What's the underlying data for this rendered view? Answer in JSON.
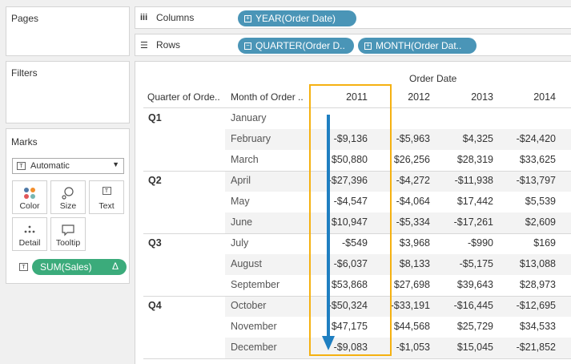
{
  "pages": {
    "title": "Pages"
  },
  "filters": {
    "title": "Filters"
  },
  "marks": {
    "title": "Marks",
    "type_value": "Automatic",
    "buttons": [
      {
        "label": "Color",
        "icon": "color-dots-icon"
      },
      {
        "label": "Size",
        "icon": "size-icon"
      },
      {
        "label": "Text",
        "icon": "text-icon"
      },
      {
        "label": "Detail",
        "icon": "detail-icon"
      },
      {
        "label": "Tooltip",
        "icon": "tooltip-icon"
      }
    ],
    "measure_pill": {
      "label": "SUM(Sales)",
      "trailing": "Δ"
    }
  },
  "shelves": {
    "columns": {
      "label": "Columns",
      "icon": "iii",
      "pills": [
        {
          "label": "YEAR(Order Date)",
          "icon": "⊞"
        }
      ]
    },
    "rows": {
      "label": "Rows",
      "icon": "☰",
      "pills": [
        {
          "label": "QUARTER(Order D..",
          "icon": "⊟"
        },
        {
          "label": "MONTH(Order Dat..",
          "icon": "⊞"
        }
      ]
    }
  },
  "table": {
    "column_group_header": "Order Date",
    "row_headers": [
      "Quarter of Orde..",
      "Month of Order .."
    ],
    "years": [
      "2011",
      "2012",
      "2013",
      "2014"
    ],
    "quarters": [
      "Q1",
      "Q2",
      "Q3",
      "Q4"
    ],
    "rows": [
      {
        "quarter": "Q1",
        "month": "January",
        "values": [
          "",
          "",
          "",
          ""
        ]
      },
      {
        "quarter": "",
        "month": "February",
        "values": [
          "-$9,136",
          "-$5,963",
          "$4,325",
          "-$24,420"
        ]
      },
      {
        "quarter": "",
        "month": "March",
        "values": [
          "$50,880",
          "$26,256",
          "$28,319",
          "$33,625"
        ]
      },
      {
        "quarter": "Q2",
        "month": "April",
        "values": [
          "-$27,396",
          "-$4,272",
          "-$11,938",
          "-$13,797"
        ]
      },
      {
        "quarter": "",
        "month": "May",
        "values": [
          "-$4,547",
          "-$4,064",
          "$17,442",
          "$5,539"
        ]
      },
      {
        "quarter": "",
        "month": "June",
        "values": [
          "$10,947",
          "-$5,334",
          "-$17,261",
          "$2,609"
        ]
      },
      {
        "quarter": "Q3",
        "month": "July",
        "values": [
          "-$549",
          "$3,968",
          "-$990",
          "$169"
        ]
      },
      {
        "quarter": "",
        "month": "August",
        "values": [
          "-$6,037",
          "$8,133",
          "-$5,175",
          "$13,088"
        ]
      },
      {
        "quarter": "",
        "month": "September",
        "values": [
          "$53,868",
          "$27,698",
          "$39,643",
          "$28,973"
        ]
      },
      {
        "quarter": "Q4",
        "month": "October",
        "values": [
          "-$50,324",
          "-$33,191",
          "-$16,445",
          "-$12,695"
        ]
      },
      {
        "quarter": "",
        "month": "November",
        "values": [
          "$47,175",
          "$44,568",
          "$25,729",
          "$34,533"
        ]
      },
      {
        "quarter": "",
        "month": "December",
        "values": [
          "-$9,083",
          "-$1,053",
          "$15,045",
          "-$21,852"
        ]
      }
    ]
  },
  "colors": {
    "dimension_pill": "#4a95b7",
    "measure_pill": "#3bab7b",
    "highlight_box": "#f5b111",
    "arrow": "#1f7fc1"
  }
}
